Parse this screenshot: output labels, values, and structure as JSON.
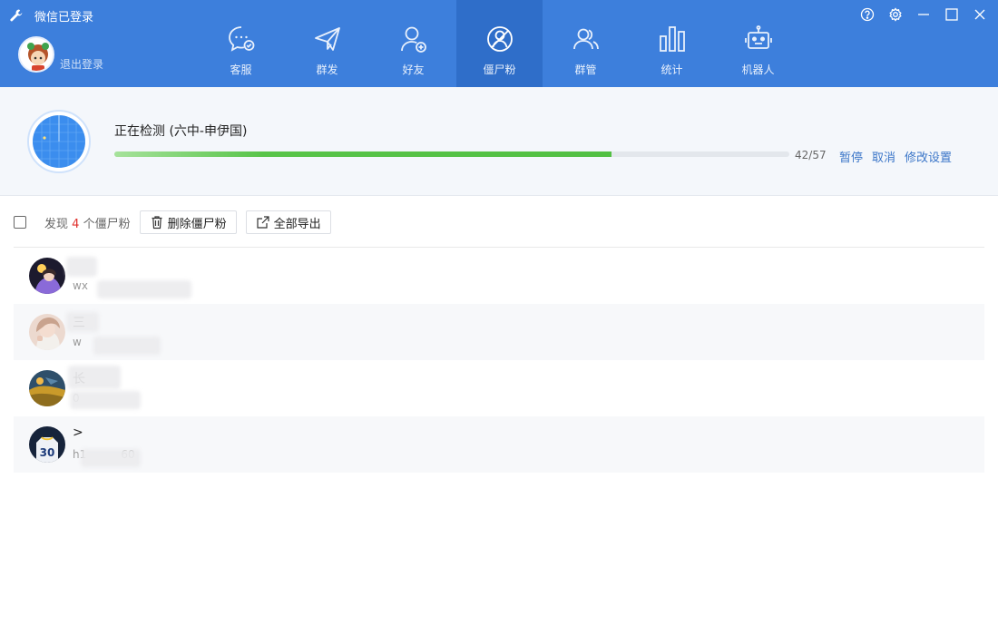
{
  "app": {
    "title": "微信已登录",
    "logout_label": "退出登录"
  },
  "nav": {
    "items": [
      {
        "label": "客服",
        "icon": "chat-check-icon"
      },
      {
        "label": "群发",
        "icon": "paper-plane-icon"
      },
      {
        "label": "好友",
        "icon": "user-add-icon"
      },
      {
        "label": "僵尸粉",
        "icon": "zombie-fans-icon",
        "active": true
      },
      {
        "label": "群管",
        "icon": "group-users-icon"
      },
      {
        "label": "统计",
        "icon": "bar-stats-icon"
      },
      {
        "label": "机器人",
        "icon": "robot-icon"
      }
    ]
  },
  "window_controls": [
    "help-icon",
    "settings-icon",
    "minimize-icon",
    "maximize-icon",
    "close-icon"
  ],
  "scan": {
    "title": "正在检测 (六中-申伊国)",
    "progress_text": "42/57",
    "progress_fraction": 0.737,
    "pause_label": "暂停",
    "cancel_label": "取消",
    "settings_label": "修改设置"
  },
  "toolbar": {
    "found_prefix": "发现",
    "found_count": "4",
    "found_suffix": "个僵尸粉",
    "delete_label": "删除僵尸粉",
    "export_label": "全部导出"
  },
  "list": [
    {
      "name": "",
      "wechat_id": "wx"
    },
    {
      "name": "三",
      "wechat_id": "w"
    },
    {
      "name": "长",
      "wechat_id": "0"
    },
    {
      "name": ">",
      "wechat_id": "h1          60"
    }
  ],
  "colors": {
    "topbar": "#3d7fdc",
    "nav_active": "#2f6ec9",
    "progress": "#52c043",
    "link": "#3b76c8",
    "count": "#e0322e"
  }
}
